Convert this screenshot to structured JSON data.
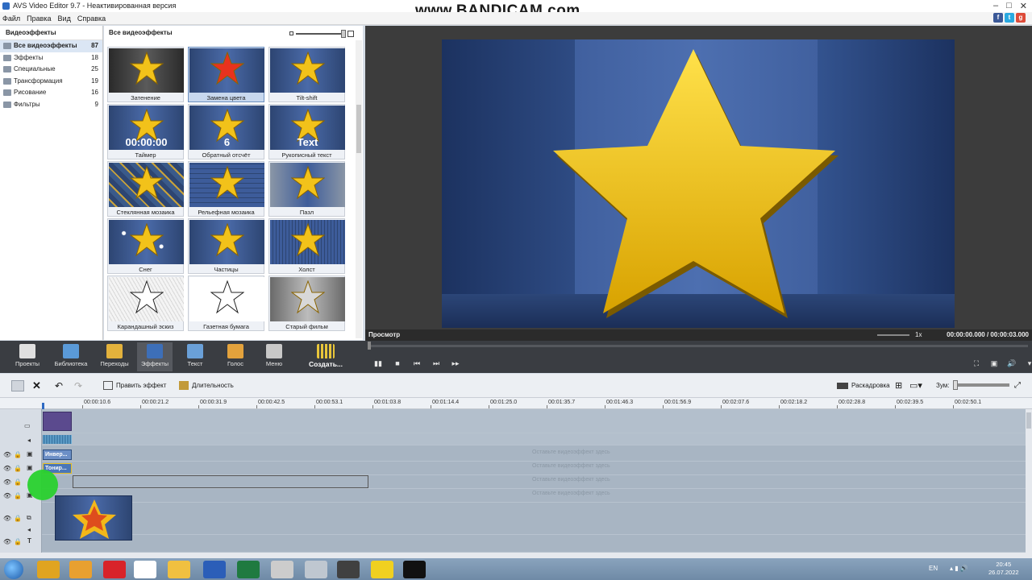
{
  "window": {
    "title": "AVS Video Editor 9.7 - Неактивированная версия",
    "watermark": "www.BANDICAM.com",
    "controls": [
      "–",
      "□",
      "✕"
    ]
  },
  "menu": [
    "Файл",
    "Правка",
    "Вид",
    "Справка"
  ],
  "social": [
    {
      "label": "f",
      "color": "#3b5998"
    },
    {
      "label": "t",
      "color": "#2aa9e0"
    },
    {
      "label": "g",
      "color": "#dd4b39"
    }
  ],
  "categories": {
    "header": "Видеоэффекты",
    "items": [
      {
        "label": "Все видеоэффекты",
        "count": "87",
        "selected": true
      },
      {
        "label": "Эффекты",
        "count": "18"
      },
      {
        "label": "Специальные",
        "count": "25"
      },
      {
        "label": "Трансформация",
        "count": "19"
      },
      {
        "label": "Рисование",
        "count": "16"
      },
      {
        "label": "Фильтры",
        "count": "9"
      }
    ]
  },
  "effects": {
    "header": "Все видеоэффекты",
    "tiles": [
      {
        "label": "Затенение",
        "star": "#f2c21a",
        "bg": "dark"
      },
      {
        "label": "Замена цвета",
        "star": "#e8321e",
        "bg": "blue",
        "selected": true
      },
      {
        "label": "Tilt-shift",
        "star": "#f2c21a",
        "bg": "blue"
      },
      {
        "label": "Таймер",
        "star": "#f2c21a",
        "bg": "blue",
        "overlay": "00:00:00"
      },
      {
        "label": "Обратный отсчёт",
        "star": "#f2c21a",
        "bg": "blue",
        "overlay": "6"
      },
      {
        "label": "Рукописный текст",
        "star": "#f2c21a",
        "bg": "blue",
        "overlay": "Text"
      },
      {
        "label": "Стеклянная мозаика",
        "star": "#f2c21a",
        "bg": "mosaic"
      },
      {
        "label": "Рельефная мозаика",
        "star": "#f2c21a",
        "bg": "grid"
      },
      {
        "label": "Пазл",
        "star": "#f2c21a",
        "bg": "puzzle"
      },
      {
        "label": "Снег",
        "star": "#f2c21a",
        "bg": "snow"
      },
      {
        "label": "Частицы",
        "star": "#f2c21a",
        "bg": "blue"
      },
      {
        "label": "Холст",
        "star": "#f2c21a",
        "bg": "canvas"
      },
      {
        "label": "Карандашный эскиз",
        "star": "#ffffff",
        "bg": "pencil"
      },
      {
        "label": "Газетная бумага",
        "star": "#ffffff",
        "bg": "newspaper"
      },
      {
        "label": "Старый фильм",
        "star": "#d8d8d8",
        "bg": "old"
      }
    ]
  },
  "preview": {
    "label": "Просмотр",
    "speed": "1x",
    "time": "00:00:00.000 / 00:00:03.000"
  },
  "toolbar": [
    {
      "label": "Проекты",
      "icon": "clapper-icon",
      "color": "#e0e0e0"
    },
    {
      "label": "Библиотека",
      "icon": "film-icon",
      "color": "#5a9ad8"
    },
    {
      "label": "Переходы",
      "icon": "transition-icon",
      "color": "#e3b23c"
    },
    {
      "label": "Эффекты",
      "icon": "star-icon",
      "color": "#3d6fb8",
      "selected": true
    },
    {
      "label": "Текст",
      "icon": "text-icon",
      "color": "#6aa0d8"
    },
    {
      "label": "Голос",
      "icon": "mic-icon",
      "color": "#e3a23c"
    },
    {
      "label": "Меню",
      "icon": "disc-icon",
      "color": "#c8c8c8"
    }
  ],
  "create_label": "Создать...",
  "timeline_toolbar": {
    "edit_effect": "Править эффект",
    "duration": "Длительность",
    "storyboard": "Раскадровка",
    "zoom": "Зум:"
  },
  "ruler": [
    "00:00:10.6",
    "00:00:21.2",
    "00:00:31.9",
    "00:00:42.5",
    "00:00:53.1",
    "00:01:03.8",
    "00:01:14.4",
    "00:01:25.0",
    "00:01:35.7",
    "00:01:46.3",
    "00:01:56.9",
    "00:02:07.6",
    "00:02:18.2",
    "00:02:28.8",
    "00:02:39.5",
    "00:02:50.1"
  ],
  "tracks": {
    "hint": "Оставьте видеоэффект здесь",
    "clip1": "Инвер...",
    "clip2": "Тониp..."
  },
  "taskbar": {
    "lang": "EN",
    "time": "20:45",
    "date": "26.07.2022",
    "apps": [
      {
        "icon": "chrome-icon",
        "color": "#e0a420"
      },
      {
        "icon": "media-player-icon",
        "color": "#e8a030"
      },
      {
        "icon": "opera-icon",
        "color": "#d8232a"
      },
      {
        "icon": "yandex-icon",
        "color": "#ffffff"
      },
      {
        "icon": "explorer-icon",
        "color": "#f0c040"
      },
      {
        "icon": "word-icon",
        "color": "#2b5eb8"
      },
      {
        "icon": "excel-icon",
        "color": "#1f7a40"
      },
      {
        "icon": "reel-icon",
        "color": "#cccccc"
      },
      {
        "icon": "wand-icon",
        "color": "#bfc7d0"
      },
      {
        "icon": "avs-icon",
        "color": "#404040"
      },
      {
        "icon": "yandex-browser-icon",
        "color": "#f0d020"
      },
      {
        "icon": "bandicam-icon",
        "color": "#111111"
      }
    ]
  }
}
